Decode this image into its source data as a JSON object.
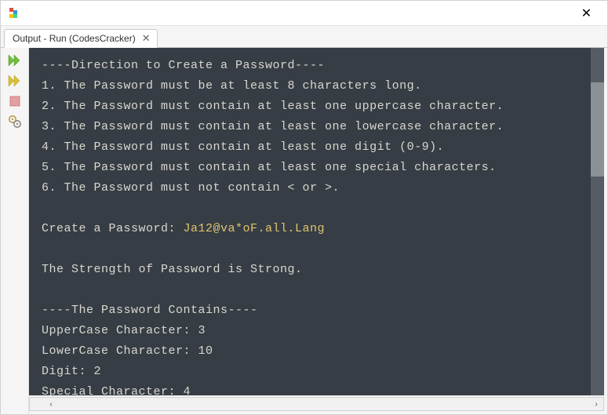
{
  "window": {
    "close_glyph": "✕"
  },
  "tab": {
    "label": "Output - Run (CodesCracker)",
    "close_glyph": "✕"
  },
  "console": {
    "lines": [
      {
        "text": "----Direction to Create a Password----"
      },
      {
        "text": "1. The Password must be at least 8 characters long."
      },
      {
        "text": "2. The Password must contain at least one uppercase character."
      },
      {
        "text": "3. The Password must contain at least one lowercase character."
      },
      {
        "text": "4. The Password must contain at least one digit (0-9)."
      },
      {
        "text": "5. The Password must contain at least one special characters."
      },
      {
        "text": "6. The Password must not contain < or >."
      },
      {
        "text": ""
      },
      {
        "prefix": "Create a Password: ",
        "highlight": "Ja12@va*oF.all.Lang"
      },
      {
        "text": ""
      },
      {
        "text": "The Strength of Password is Strong."
      },
      {
        "text": ""
      },
      {
        "text": "----The Password Contains----"
      },
      {
        "text": "UpperCase Character: 3"
      },
      {
        "text": "LowerCase Character: 10"
      },
      {
        "text": "Digit: 2"
      },
      {
        "text": "Special Character: 4"
      }
    ]
  },
  "toolbar": {
    "items": [
      {
        "name": "rerun-icon"
      },
      {
        "name": "rerun-alt-icon"
      },
      {
        "name": "stop-icon"
      },
      {
        "name": "settings-icon"
      }
    ]
  },
  "scroll": {
    "left_glyph": "‹",
    "right_glyph": "›"
  }
}
